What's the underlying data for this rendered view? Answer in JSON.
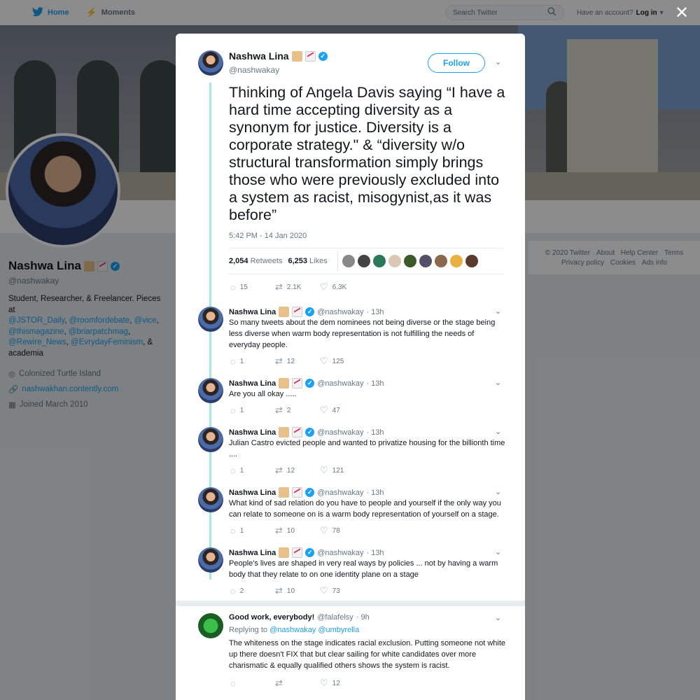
{
  "nav": {
    "home": "Home",
    "moments": "Moments",
    "search_placeholder": "Search Twitter",
    "account_prompt": "Have an account?",
    "login": "Log in"
  },
  "profile": {
    "name": "Nashwa Lina",
    "handle": "@nashwakay",
    "bio_text": "Student, Researcher, & Freelancer. Pieces at",
    "bio_links": [
      "@JSTOR_Daily",
      "@roomfordebate",
      "@vice",
      "@thismagazine",
      "@briarpatchmag",
      "@Rewire_News",
      "@EvrydayFeminism"
    ],
    "bio_tail": "academia",
    "location": "Colonized Turtle Island",
    "website": "nashwakhan.contently.com",
    "joined": "Joined March 2010"
  },
  "footer": {
    "links": [
      "© 2020 Twitter",
      "About",
      "Help Center",
      "Terms",
      "Privacy policy",
      "Cookies",
      "Ads info"
    ]
  },
  "modal": {
    "main_tweet": {
      "name": "Nashwa Lina",
      "handle": "@nashwakay",
      "follow_label": "Follow",
      "text": "Thinking of Angela Davis saying “I have a hard time accepting diversity as a synonym for justice. Diversity is a corporate strategy.\" & “diversity w/o structural transformation simply brings those who were previously excluded into a system as racist, misogynist,as it was before”",
      "time": "5:42 PM - 14 Jan 2020",
      "retweets_count": "2,054",
      "retweets_label": "Retweets",
      "likes_count": "6,253",
      "likes_label": "Likes",
      "replies": "15",
      "retweets_short": "2.1K",
      "likes_short": "6.3K"
    },
    "thread": [
      {
        "name": "Nashwa Lina",
        "handle": "@nashwakay",
        "time": "· 13h",
        "text": "So many tweets about the dem nominees not being diverse or the stage being less diverse when warm body representation is not fulfilling the needs of everyday people.",
        "replies": "1",
        "retweets": "12",
        "likes": "125"
      },
      {
        "name": "Nashwa Lina",
        "handle": "@nashwakay",
        "time": "· 13h",
        "text": "Are you all okay .....",
        "replies": "1",
        "retweets": "2",
        "likes": "47"
      },
      {
        "name": "Nashwa Lina",
        "handle": "@nashwakay",
        "time": "· 13h",
        "text": "Julian Castro evicted people and wanted to privatize housing for the billionth time ....",
        "replies": "1",
        "retweets": "12",
        "likes": "121"
      },
      {
        "name": "Nashwa Lina",
        "handle": "@nashwakay",
        "time": "· 13h",
        "text": "What kind of sad relation do you have to people and yourself if the only way you can relate to someone on is a warm body representation of yourself on a stage.",
        "replies": "1",
        "retweets": "10",
        "likes": "78"
      },
      {
        "name": "Nashwa Lina",
        "handle": "@nashwakay",
        "time": "· 13h",
        "text": "People's lives are shaped in very real ways by policies ... not by having a warm body that they relate to on one identity plane on a stage",
        "replies": "2",
        "retweets": "10",
        "likes": "73"
      }
    ],
    "reply": {
      "name": "Good work, everybody!",
      "handle": "@falafelsy",
      "time": "· 9h",
      "replying_label": "Replying to",
      "replying_to": "@nashwakay @umbyrella",
      "text": "The whiteness on the stage indicates racial exclusion. Putting someone not white up there doesn't FIX that but clear sailing for white candidates over more charismatic & equally qualified others shows the system is racist.",
      "likes": "12"
    }
  },
  "colors": {
    "accent": "#1da1f2",
    "thread_line": "#a8e6e8",
    "muted": "#657786"
  }
}
